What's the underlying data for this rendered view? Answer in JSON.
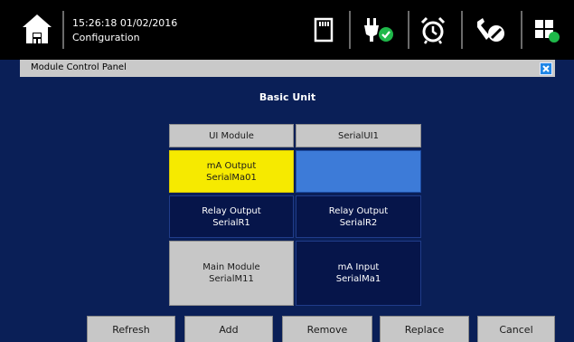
{
  "status_bar": {
    "time": "15:26:18",
    "date": "01/02/2016",
    "screen_name": "Configuration",
    "icons": [
      "home-icon",
      "sd-card-icon",
      "power-plug-ok-icon",
      "alarm-clock-icon",
      "tools-icon",
      "windows-overlap-icon"
    ]
  },
  "panel": {
    "title": "Module Control Panel",
    "heading": "Basic Unit"
  },
  "modules": {
    "ui": {
      "name": "UI Module",
      "serial": "SerialUI1"
    },
    "ma_output": {
      "name": "mA Output",
      "serial": "SerialMa01"
    },
    "relay1": {
      "name": "Relay Output",
      "serial": "SerialR1"
    },
    "relay2": {
      "name": "Relay Output",
      "serial": "SerialR2"
    },
    "main": {
      "name": "Main Module",
      "serial": "SerialM11"
    },
    "ma_input": {
      "name": "mA Input",
      "serial": "SerialMa1"
    }
  },
  "buttons": {
    "refresh": "Refresh",
    "add": "Add",
    "remove": "Remove",
    "replace": "Replace",
    "cancel": "Cancel"
  },
  "colors": {
    "background": "#0a1f57",
    "selected": "#f6ea00",
    "empty_slot": "#3d7bd8",
    "status_ok": "#1fb84a",
    "close_button": "#1f86e6"
  }
}
